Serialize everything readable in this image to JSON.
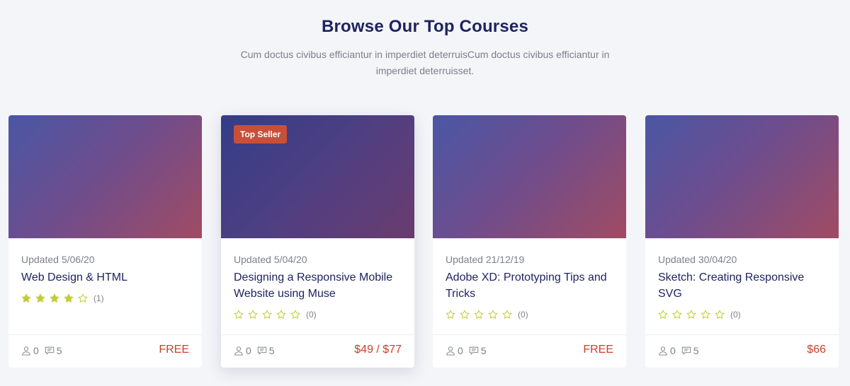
{
  "header": {
    "title": "Browse Our Top Courses",
    "subtitle": "Cum doctus civibus efficiantur in imperdiet deterruisCum doctus civibus efficiantur in imperdiet deterruisset."
  },
  "colors": {
    "title": "#1e2460",
    "price": "#c9412a",
    "badge": "#c94f38",
    "star_filled": "#c3cc3a",
    "star_empty": "#c3cc3a"
  },
  "courses": [
    {
      "updated": "Updated 5/06/20",
      "title": "Web Design & HTML",
      "rating": 4,
      "rating_count": "(1)",
      "students": "0",
      "comments": "5",
      "price": "FREE",
      "badge": ""
    },
    {
      "updated": "Updated 5/04/20",
      "title": "Designing a Responsive Mobile Website using Muse",
      "rating": 0,
      "rating_count": "(0)",
      "students": "0",
      "comments": "5",
      "price": "$49 / $77",
      "badge": "Top Seller"
    },
    {
      "updated": "Updated 21/12/19",
      "title": "Adobe XD: Prototyping Tips and Tricks",
      "rating": 0,
      "rating_count": "(0)",
      "students": "0",
      "comments": "5",
      "price": "FREE",
      "badge": ""
    },
    {
      "updated": "Updated 30/04/20",
      "title": "Sketch: Creating Responsive SVG",
      "rating": 0,
      "rating_count": "(0)",
      "students": "0",
      "comments": "5",
      "price": "$66",
      "badge": ""
    }
  ],
  "icons": {
    "star": "star-icon",
    "students": "user-icon",
    "comments": "comment-icon"
  }
}
